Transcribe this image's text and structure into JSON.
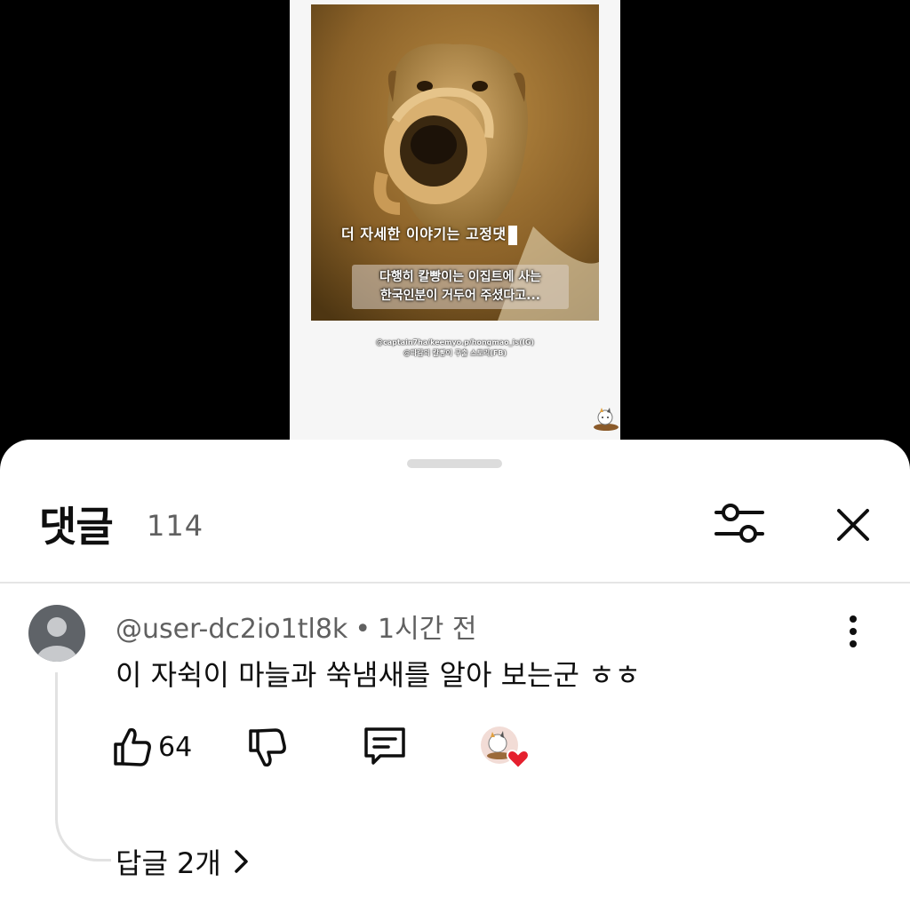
{
  "video": {
    "overlay_caption": "더 자세한 이야기는 고정댓",
    "subtitle_line1": "다행히 칼빵이는 이집트에 사는",
    "subtitle_line2": "한국인분이 거두어 주셨다고...",
    "credit_line1": "@captain7ha/keemyo.p/hongmao_is(IG)",
    "credit_line2": "@다람의 칼빵이 구출 스토리(FB)"
  },
  "comments_panel": {
    "title": "댓글",
    "count": "114",
    "filter_icon": "sliders-icon",
    "close_icon": "close-icon"
  },
  "comment": {
    "author": "@user-dc2io1tl8k",
    "separator": "•",
    "time": "1시간 전",
    "text": "이 자쉭이 마늘과 쑥냄새를 알아 보는군 ㅎㅎ",
    "like_count": "64",
    "replies_label": "답글 2개",
    "heart_color": "#e5202e"
  },
  "colors": {
    "sheet_bg": "#ffffff",
    "text_primary": "#0f0f0f",
    "text_secondary": "#606060",
    "divider": "#e5e5e5"
  }
}
